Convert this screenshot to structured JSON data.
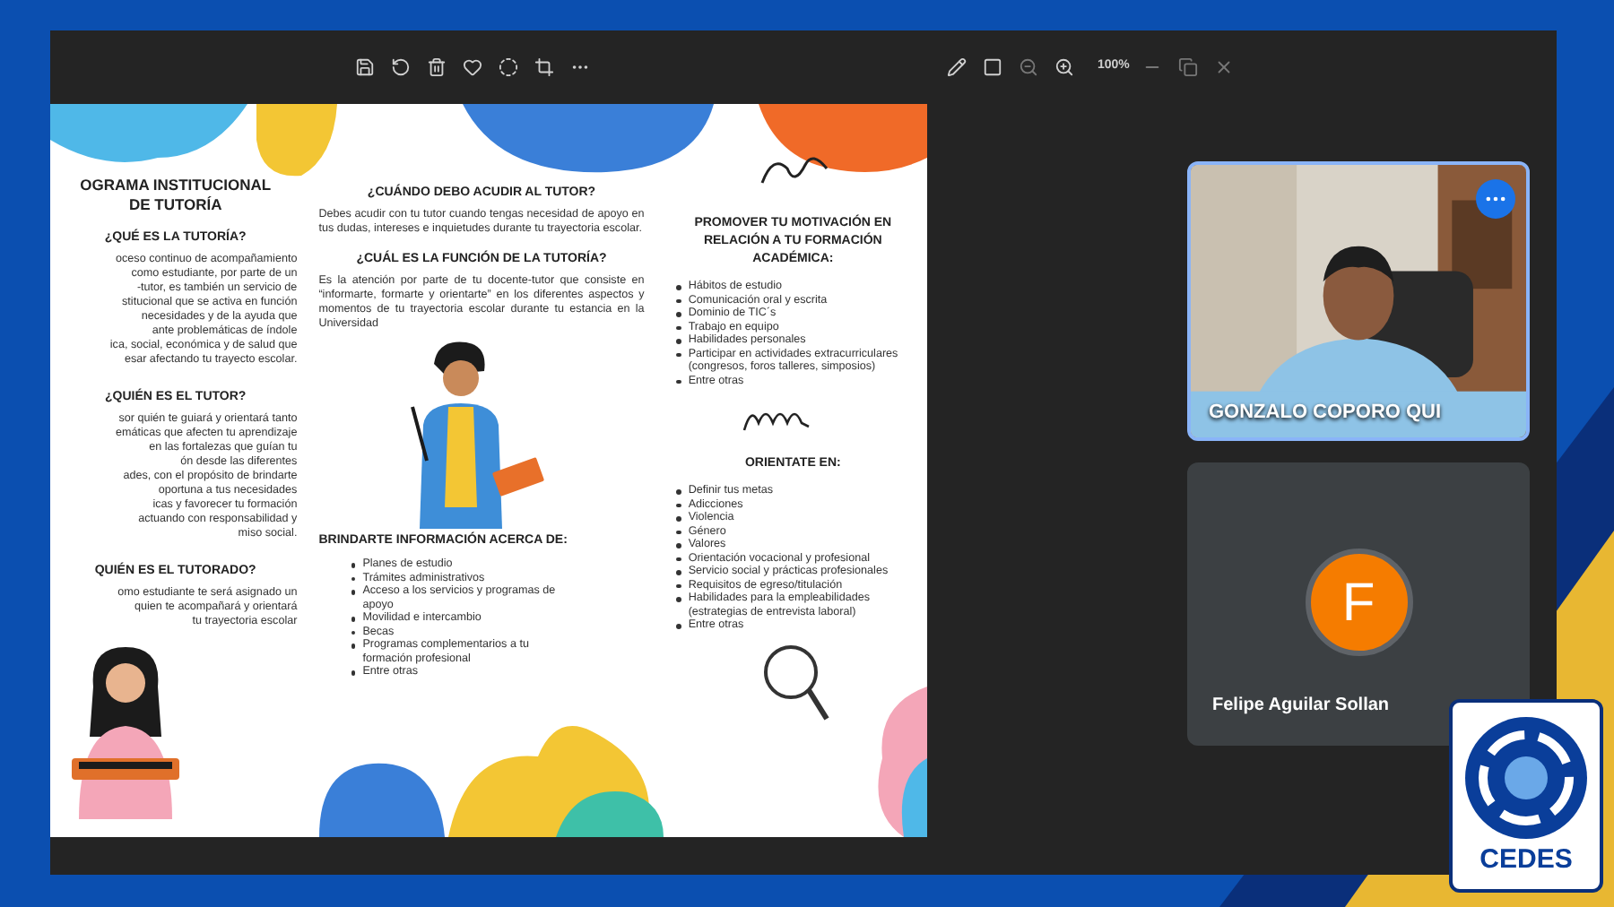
{
  "toolbar": {
    "zoom": "100%"
  },
  "document": {
    "left_column": {
      "title": "OGRAMA INSTITUCIONAL\nDE TUTORÍA",
      "sections": [
        {
          "heading": "¿QUÉ ES LA TUTORÍA?",
          "body": "oceso continuo de acompañamiento\ncomo estudiante, por parte de un\n-tutor, es también un servicio de\nstitucional que se activa en función\nnecesidades y de la ayuda que\nante problemáticas de índole\nica, social, económica y de salud que\nesar afectando tu trayecto escolar."
        },
        {
          "heading": "¿QUIÉN ES EL TUTOR?",
          "body": "sor quién te guiará y orientará tanto\nemáticas que afecten tu aprendizaje\nen las fortalezas que guían tu\nón desde las diferentes\nades, con el propósito de brindarte\noportuna a tus necesidades\nicas y favorecer tu formación\nactuando con responsabilidad y\nmiso social."
        },
        {
          "heading": "QUIÉN ES EL TUTORADO?",
          "body": "omo estudiante te será asignado un\nquien te acompañará y orientará\ntu trayectoria escolar"
        }
      ]
    },
    "middle_column": {
      "sections": [
        {
          "heading": "¿CUÁNDO DEBO ACUDIR AL TUTOR?",
          "body": "Debes acudir con tu tutor cuando tengas necesidad de apoyo en tus dudas, intereses e inquietudes durante tu trayectoria escolar."
        },
        {
          "heading": "¿CUÁL ES LA FUNCIÓN DE LA TUTORÍA?",
          "body": "Es la atención por parte de tu docente-tutor que consiste en “informarte, formarte y orientarte” en los diferentes aspectos y momentos de tu trayectoria escolar durante tu estancia en la Universidad"
        }
      ],
      "list_heading": "BRINDARTE INFORMACIÓN ACERCA DE:",
      "items": [
        "Planes de estudio",
        "Trámites administrativos",
        "Acceso a los servicios y programas de apoyo",
        "Movilidad e intercambio",
        "Becas",
        "Programas complementarios a tu formación profesional",
        "Entre otras"
      ]
    },
    "right_column": {
      "lists": [
        {
          "heading": "PROMOVER TU MOTIVACIÓN EN RELACIÓN A TU FORMACIÓN ACADÉMICA:",
          "items": [
            "Hábitos de estudio",
            "Comunicación oral y escrita",
            "Dominio de TIC´s",
            "Trabajo en equipo",
            "Habilidades personales",
            "Participar en actividades extracurriculares (congresos, foros talleres, simposios)",
            "Entre otras"
          ]
        },
        {
          "heading": "ORIENTATE EN:",
          "items": [
            "Definir tus metas",
            "Adicciones",
            "Violencia",
            "Género",
            "Valores",
            "Orientación vocacional y profesional",
            "Servicio social y prácticas profesionales",
            "Requisitos de egreso/titulación",
            "Habilidades para la empleabilidades (estrategias de entrevista laboral)",
            "Entre otras"
          ]
        }
      ]
    }
  },
  "participants": [
    {
      "kind": "video",
      "name": "GONZALO COPORO QUI",
      "speaking": true
    },
    {
      "kind": "avatar",
      "initial": "F",
      "name": "Felipe Aguilar Sollan",
      "speaking": false
    }
  ],
  "logo": {
    "text": "CEDES"
  }
}
